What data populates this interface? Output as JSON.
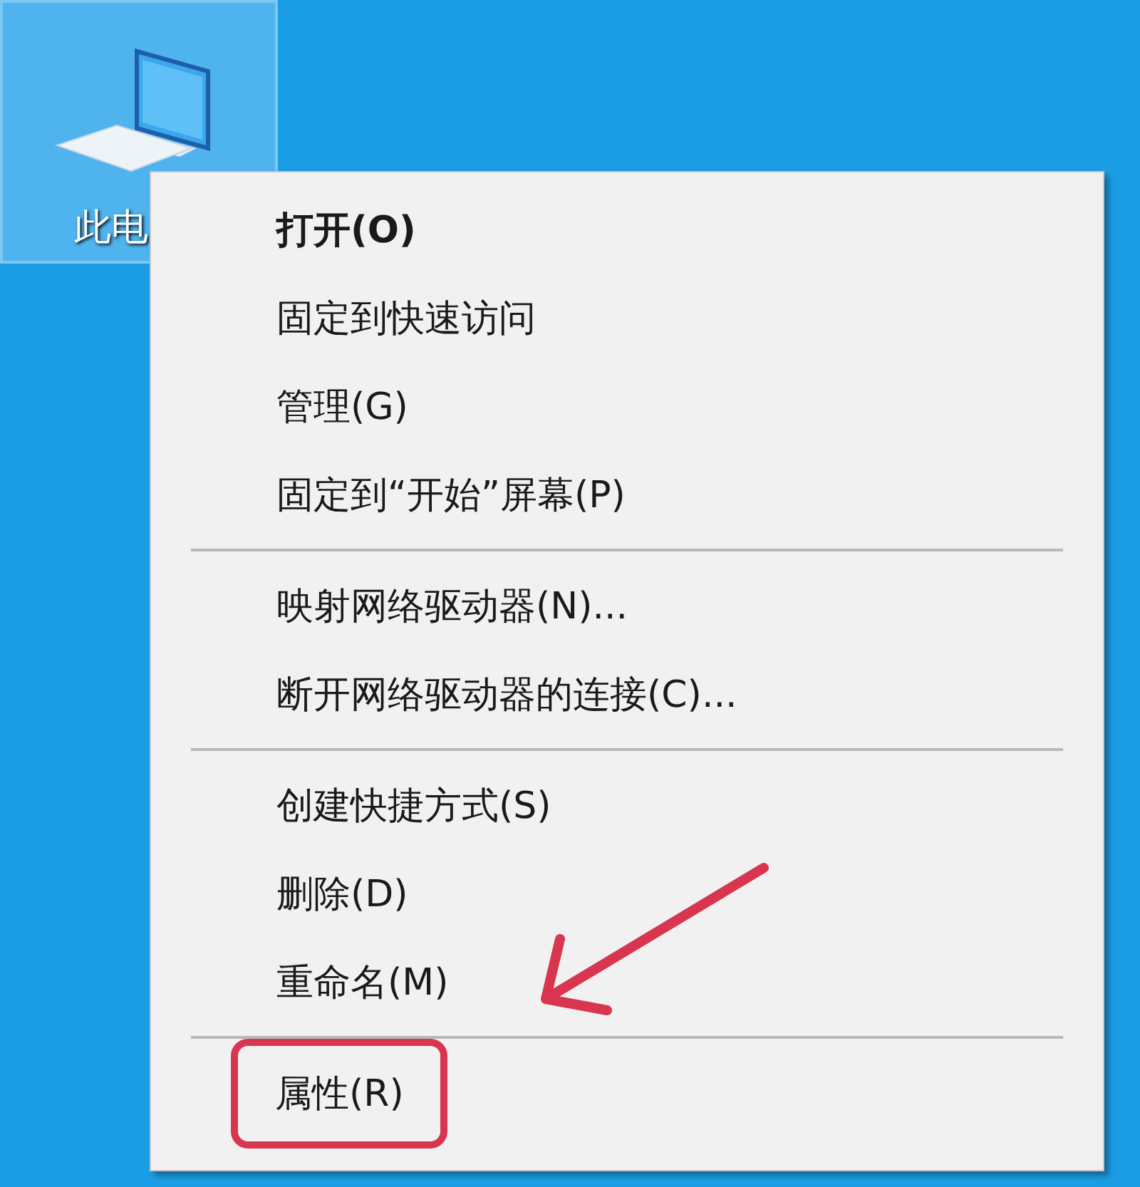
{
  "desktop_icons": [
    {
      "label": "此电",
      "selected": true
    }
  ],
  "context_menu": {
    "items": [
      {
        "kind": "item",
        "label": "打开(O)",
        "bold": true,
        "highlighted": false
      },
      {
        "kind": "item",
        "label": "固定到快速访问",
        "bold": false,
        "highlighted": false
      },
      {
        "kind": "item",
        "label": "管理(G)",
        "bold": false,
        "highlighted": false
      },
      {
        "kind": "item",
        "label": "固定到“开始”屏幕(P)",
        "bold": false,
        "highlighted": false
      },
      {
        "kind": "separator"
      },
      {
        "kind": "item",
        "label": "映射网络驱动器(N)...",
        "bold": false,
        "highlighted": false
      },
      {
        "kind": "item",
        "label": "断开网络驱动器的连接(C)...",
        "bold": false,
        "highlighted": false
      },
      {
        "kind": "separator"
      },
      {
        "kind": "item",
        "label": "创建快捷方式(S)",
        "bold": false,
        "highlighted": false
      },
      {
        "kind": "item",
        "label": "删除(D)",
        "bold": false,
        "highlighted": false
      },
      {
        "kind": "item",
        "label": "重命名(M)",
        "bold": false,
        "highlighted": false
      },
      {
        "kind": "separator"
      },
      {
        "kind": "item",
        "label": "属性(R)",
        "bold": false,
        "highlighted": true
      }
    ]
  }
}
